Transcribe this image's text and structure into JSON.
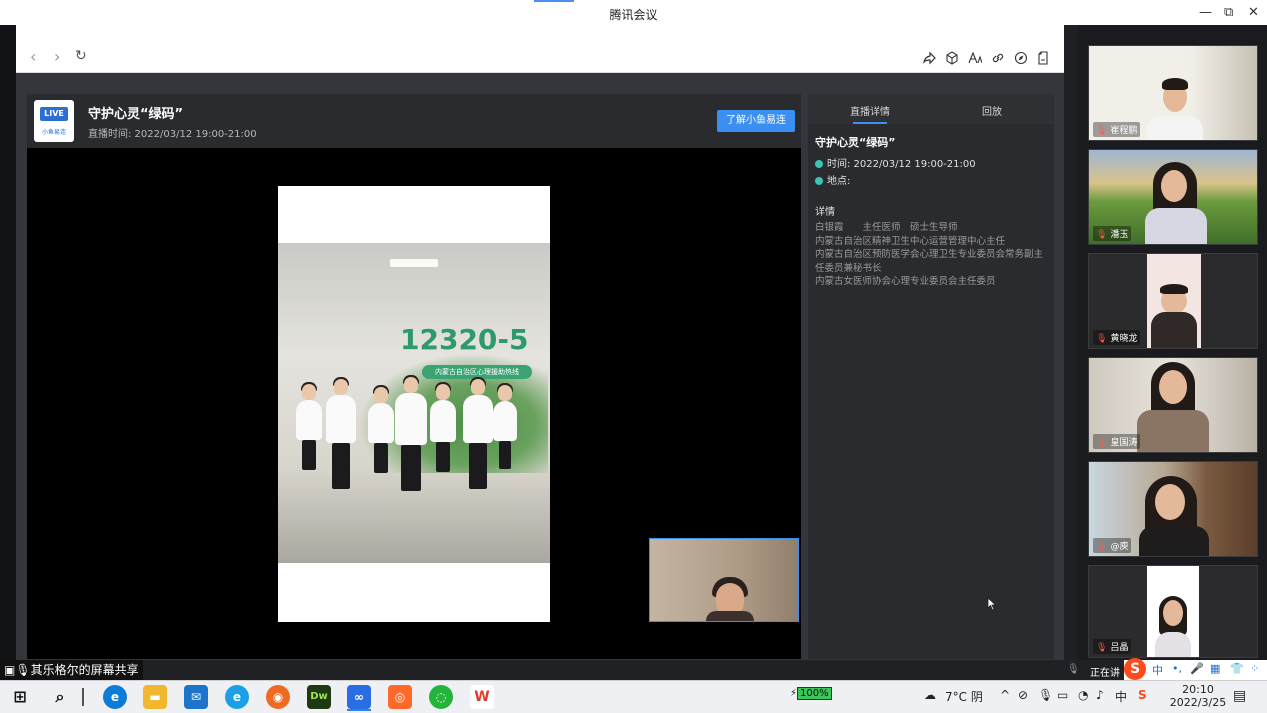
{
  "app": {
    "title": "腾讯会议"
  },
  "window_controls": {
    "minimize": "—",
    "maximize": "⧉",
    "close": "✕"
  },
  "browser": {
    "back": "‹",
    "forward": "›",
    "refresh": "↻",
    "tools": [
      "share-icon",
      "cube-icon",
      "font-icon",
      "link-icon",
      "compass-icon",
      "file-icon"
    ]
  },
  "event": {
    "logo_badge": "LIVE",
    "logo_sub": "小鱼易连",
    "title": "守护心灵“绿码”",
    "time_line": "直播时间: 2022/03/12 19:00-21:00",
    "learn_button": "了解小鱼易连"
  },
  "video": {
    "sign_number": "12320-5",
    "sign_caption": "内蒙古自治区心理援助热线"
  },
  "detail": {
    "tabs": [
      "直播详情",
      "回放"
    ],
    "title": "守护心灵“绿码”",
    "time": "时间: 2022/03/12 19:00-21:00",
    "place": "地点:",
    "section": "详情",
    "lines": [
      "白银霞　　主任医师　硕士生导师",
      "内蒙古自治区精神卫生中心运营管理中心主任",
      "内蒙古自治区预防医学会心理卫生专业委员会常务副主",
      "任委员兼秘书长",
      "内蒙古女医师协会心理专业委员会主任委员"
    ]
  },
  "participants": [
    "崔程鹏",
    "潘玉",
    "黄晓龙",
    "皇国涛",
    "@庾",
    "吕晶"
  ],
  "sharebar": {
    "label": "其乐格尔的屏幕共享",
    "speaking": "正在讲"
  },
  "ime": [
    "中",
    "•,",
    "🎤",
    "▦",
    "👕",
    "⁘"
  ],
  "taskbar": {
    "battery": "100%",
    "weather": "7°C 阴",
    "time": "20:10",
    "date": "2022/3/25"
  }
}
